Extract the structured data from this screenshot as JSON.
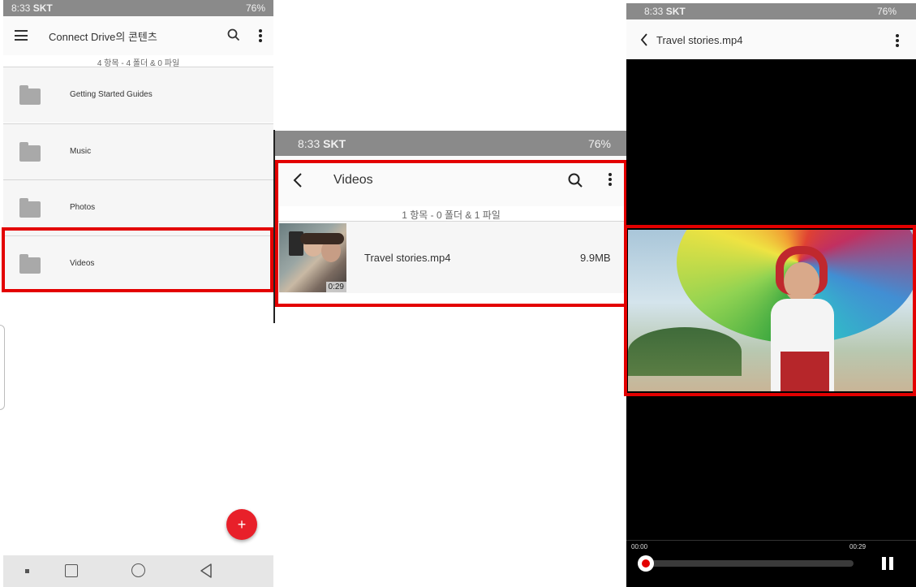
{
  "screen1": {
    "status": {
      "time": "8:33",
      "carrier": "SKT",
      "right": "76%"
    },
    "title": "Connect Drive의 콘텐츠",
    "summary": "4 항목 - 4 폴더 & 0 파일",
    "folders": [
      {
        "label": "Getting Started Guides"
      },
      {
        "label": "Music"
      },
      {
        "label": "Photos"
      },
      {
        "label": "Videos"
      }
    ],
    "fab_label": "+"
  },
  "screen2": {
    "status": {
      "time": "8:33",
      "carrier": "SKT",
      "right": "76%"
    },
    "title": "Videos",
    "summary": "1 항목 - 0 폴더 & 1 파일",
    "file": {
      "name": "Travel stories.mp4",
      "size": "9.9MB",
      "duration": "0:29"
    }
  },
  "screen3": {
    "status": {
      "time": "8:33",
      "carrier": "SKT",
      "right": "76%"
    },
    "title": "Travel stories.mp4",
    "time_start": "00:00",
    "time_end": "00:29",
    "progress": 0.0
  },
  "colors": {
    "highlight": "#e30000",
    "fab": "#e8202a"
  },
  "icons": {
    "menu": "hamburger-icon",
    "search": "search-icon",
    "more": "more-vert-icon",
    "back": "back-arrow-icon"
  }
}
